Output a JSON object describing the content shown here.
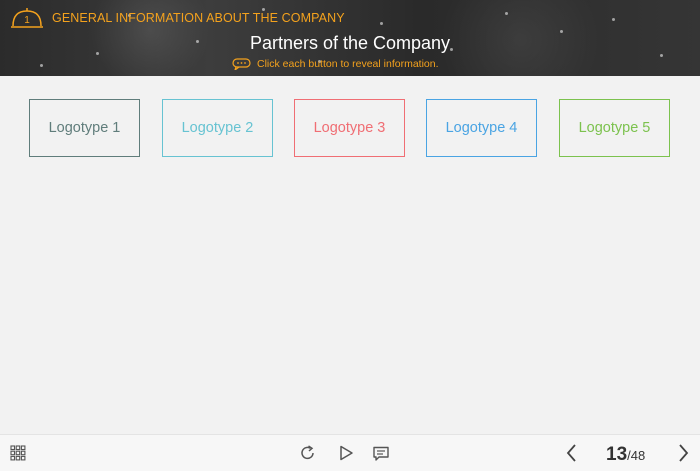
{
  "header": {
    "section_number": "1",
    "section_title": "GENERAL INFORMATION ABOUT THE COMPANY",
    "page_title": "Partners of the Company",
    "hint_text": "Click each button to reveal information."
  },
  "logos": [
    {
      "label": "Logotype 1",
      "color": "#607d7b"
    },
    {
      "label": "Logotype 2",
      "color": "#67c3d2"
    },
    {
      "label": "Logotype 3",
      "color": "#f06e74"
    },
    {
      "label": "Logotype 4",
      "color": "#4aa4e3"
    },
    {
      "label": "Logotype 5",
      "color": "#7cc24e"
    }
  ],
  "footer": {
    "current_page": "13",
    "total_pages": "/48",
    "icons": [
      "menu-grid-icon",
      "replay-icon",
      "play-icon",
      "notes-icon",
      "prev-arrow-icon",
      "next-arrow-icon"
    ]
  },
  "colors": {
    "accent": "#f4a21d",
    "header_bg": "#2f2f2f",
    "body_bg": "#f2f2f2"
  }
}
